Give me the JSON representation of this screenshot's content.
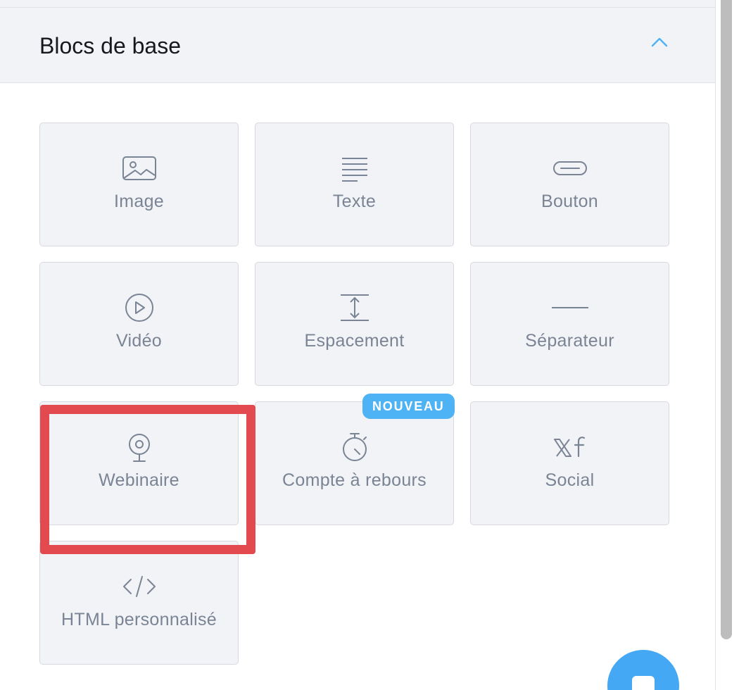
{
  "section": {
    "title": "Blocs de base",
    "toggle_icon": "chevron-up-icon"
  },
  "blocks": [
    {
      "label": "Image",
      "icon": "image-icon"
    },
    {
      "label": "Texte",
      "icon": "text-lines-icon"
    },
    {
      "label": "Bouton",
      "icon": "button-icon"
    },
    {
      "label": "Vidéo",
      "icon": "play-circle-icon"
    },
    {
      "label": "Espacement",
      "icon": "spacing-icon"
    },
    {
      "label": "Séparateur",
      "icon": "divider-icon"
    },
    {
      "label": "Webinaire",
      "icon": "webcam-icon"
    },
    {
      "label": "Compte à rebours",
      "icon": "stopwatch-icon",
      "badge": "NOUVEAU"
    },
    {
      "label": "Social",
      "icon": "x-facebook-icon"
    },
    {
      "label": "HTML personnalisé",
      "icon": "code-icon"
    }
  ],
  "colors": {
    "accent": "#4db3f5",
    "highlight": "#e24a4f",
    "tile_background": "#f2f3f7",
    "label_text": "#7a8494"
  }
}
